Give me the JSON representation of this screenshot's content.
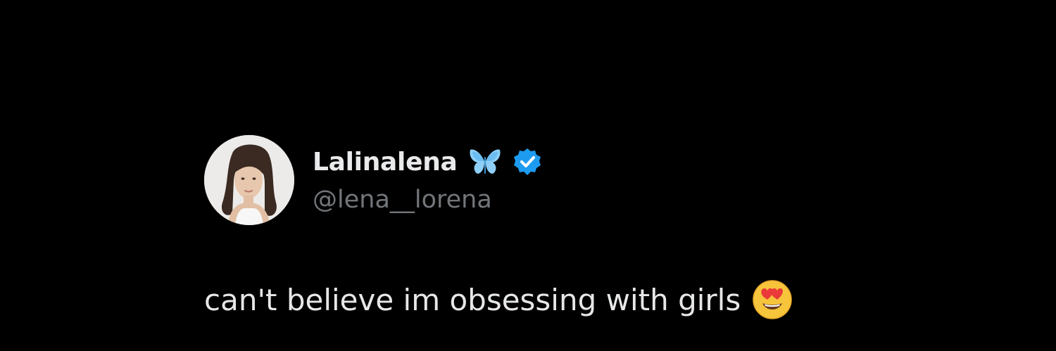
{
  "tweet": {
    "author": {
      "display_name": "Lalinalena",
      "handle": "@lena__lorena",
      "verified": true,
      "name_decoration_icon": "butterfly-icon",
      "verified_icon": "verified-badge-icon"
    },
    "text": "can't believe im obsessing with girls",
    "trailing_emoji_icon": "heart-eyes-emoji-icon"
  },
  "colors": {
    "background": "#000000",
    "name_text": "#e9eaeb",
    "handle_text": "#72767a",
    "body_text": "#e6e7e8",
    "verified_blue": "#1d9bf0",
    "butterfly_blue": "#8ecff7"
  }
}
